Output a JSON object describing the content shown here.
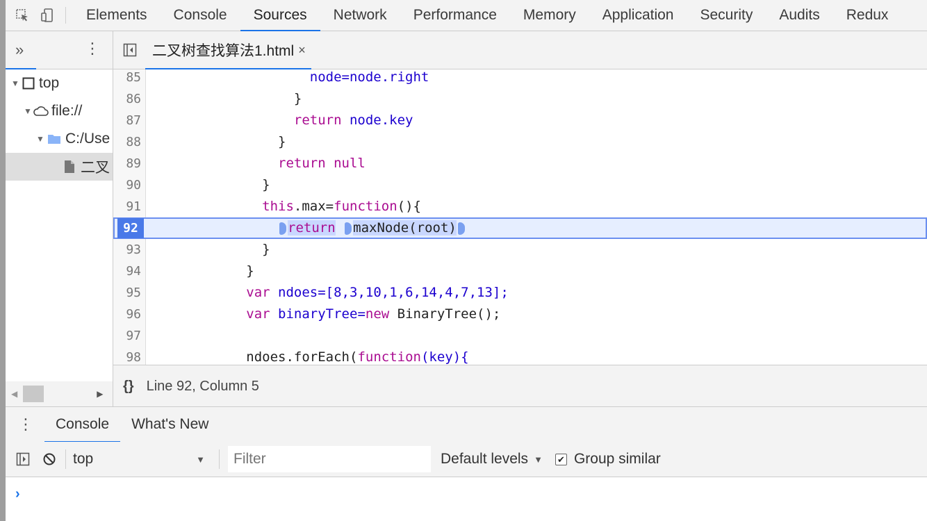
{
  "toolbar": {
    "tabs": [
      "Elements",
      "Console",
      "Sources",
      "Network",
      "Performance",
      "Memory",
      "Application",
      "Security",
      "Audits",
      "Redux"
    ],
    "active_tab": "Sources"
  },
  "navigator": {
    "more": "»",
    "tree": [
      {
        "label": "top",
        "icon": "frame-icon"
      },
      {
        "label": "file://",
        "icon": "cloud-icon"
      },
      {
        "label": "C:/Use",
        "icon": "folder-icon"
      },
      {
        "label": "二叉",
        "icon": "file-icon"
      }
    ]
  },
  "editor": {
    "file_tab": "二叉树查找算法1.html",
    "close": "×",
    "lines": [
      {
        "n": "85"
      },
      {
        "n": "86"
      },
      {
        "n": "87"
      },
      {
        "n": "88"
      },
      {
        "n": "89"
      },
      {
        "n": "90"
      },
      {
        "n": "91"
      },
      {
        "n": "92"
      },
      {
        "n": "93"
      },
      {
        "n": "94"
      },
      {
        "n": "95"
      },
      {
        "n": "96"
      },
      {
        "n": "97"
      },
      {
        "n": "98"
      }
    ],
    "code": {
      "l85": "node=node.right",
      "l86": "}",
      "l87_kw": "return",
      "l87_rest": " node.key",
      "l88": "}",
      "l89_kw": "return",
      "l89_rest": " null",
      "l90": "}",
      "l91_kw": "this",
      "l91_mid": ".max=",
      "l91_fn": "function",
      "l91_end": "(){",
      "l92_kw": "return",
      "l92_rest": "maxNode(root)",
      "l93": "}",
      "l94": "}",
      "l95_kw": "var",
      "l95_rest": " ndoes=[8,3,10,1,6,14,4,7,13];",
      "l96_kw": "var",
      "l96_mid": " binaryTree=",
      "l96_kw2": "new",
      "l96_rest": " BinaryTree();",
      "l98_pre": "ndoes.forEach(",
      "l98_fn": "function",
      "l98_rest": "(key){"
    }
  },
  "status": {
    "brace": "{}",
    "position": "Line 92, Column 5"
  },
  "drawer": {
    "tabs": [
      "Console",
      "What's New"
    ]
  },
  "console_bar": {
    "context": "top",
    "filter_placeholder": "Filter",
    "levels": "Default levels",
    "group_similar": "Group similar",
    "prompt": "›"
  }
}
